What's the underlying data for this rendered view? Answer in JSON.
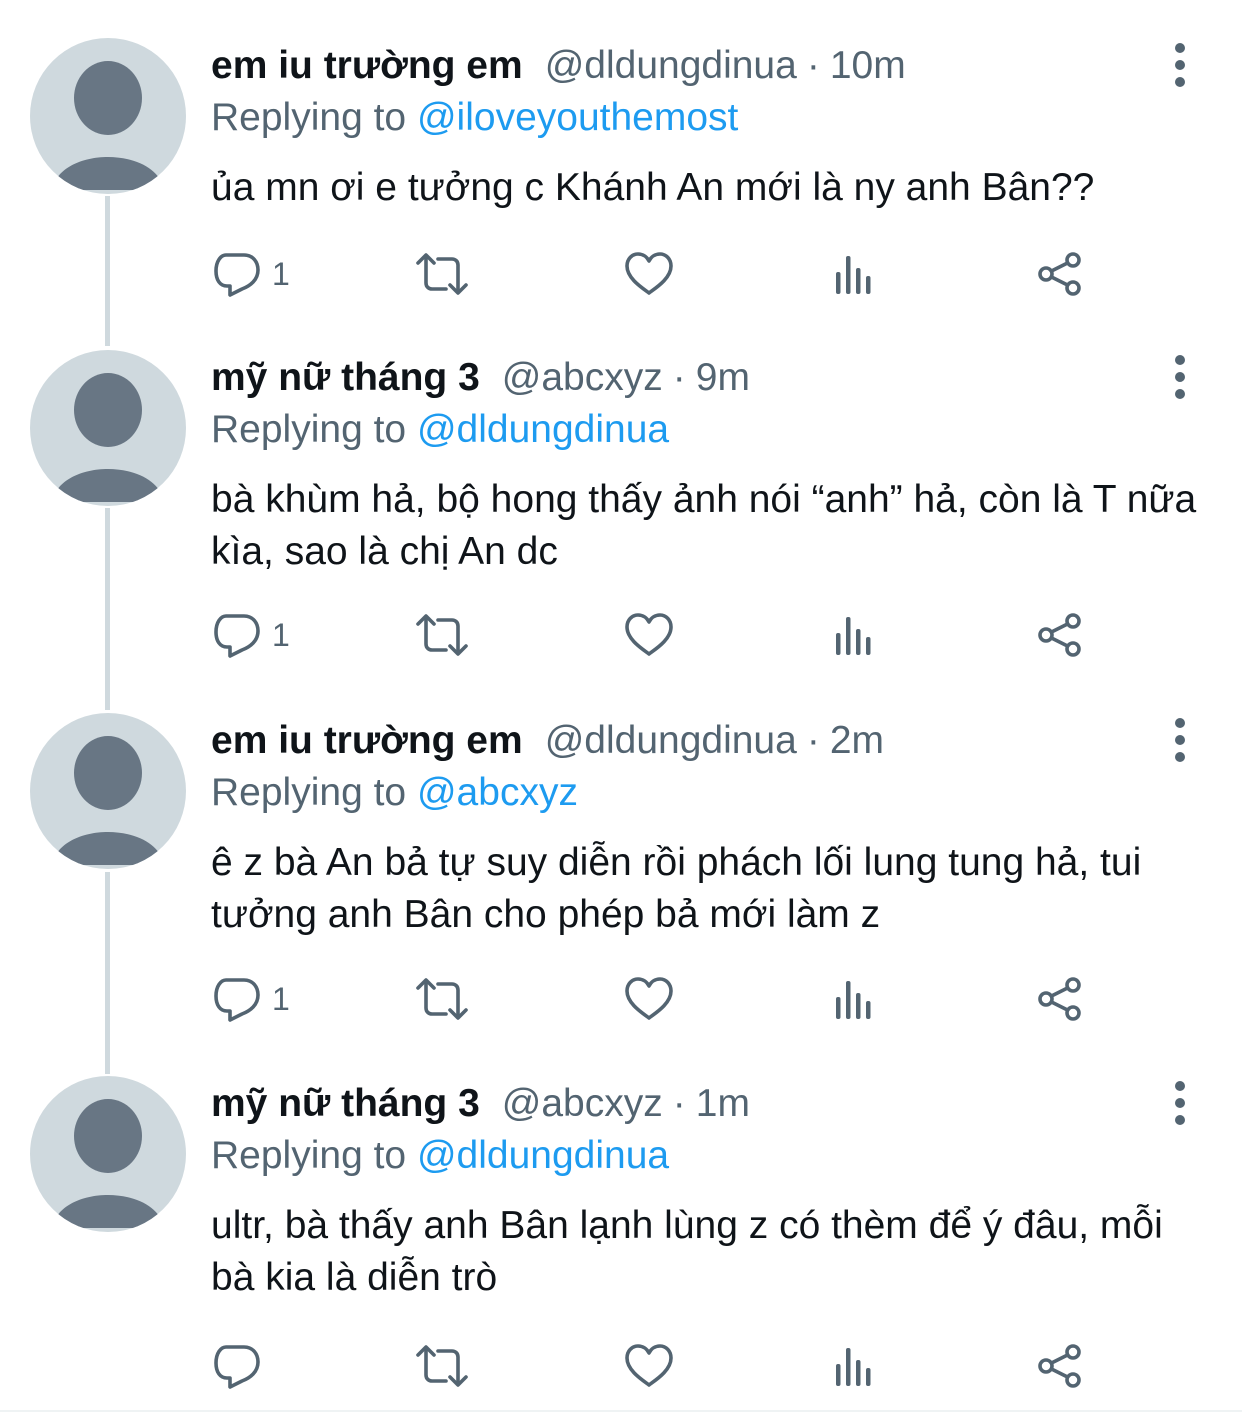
{
  "colors": {
    "text": "#0f1419",
    "muted": "#536471",
    "mention": "#1d9bf0",
    "avatar_bg": "#cfd9de",
    "avatar_fg": "#687684",
    "thread_line": "#cfd9de"
  },
  "icons": {
    "reply": "speech-bubble",
    "retweet": "loop-arrows",
    "like": "heart",
    "views": "bar-chart",
    "share": "share-nodes",
    "more": "vertical-ellipsis",
    "avatar": "default-person"
  },
  "replying_to_label": "Replying to",
  "tweets": [
    {
      "name": "em iu trường em",
      "handle": "@dldungdinua",
      "time": "10m",
      "reply_to": "@iloveyouthemost",
      "text": "ủa mn ơi e tưởng c Khánh An mới là ny anh Bân??",
      "reply_count": "1"
    },
    {
      "name": "mỹ nữ tháng 3",
      "handle": "@abcxyz",
      "time": "9m",
      "reply_to": "@dldungdinua",
      "text": "bà khùm hả, bộ hong thấy ảnh nói “anh” hả, còn là T nữa kìa, sao là chị An dc",
      "reply_count": "1"
    },
    {
      "name": "em iu trường em",
      "handle": "@dldungdinua",
      "time": "2m",
      "reply_to": "@abcxyz",
      "text": "ê z bà An bả tự suy diễn rồi phách lối lung tung hả, tui tưởng anh Bân cho phép bả mới làm z",
      "reply_count": "1"
    },
    {
      "name": "mỹ nữ tháng 3",
      "handle": "@abcxyz",
      "time": "1m",
      "reply_to": "@dldungdinua",
      "text": "ultr, bà thấy anh Bân lạnh lùng z có thèm để ý đâu, mỗi bà kia là diễn trò",
      "reply_count": ""
    }
  ]
}
